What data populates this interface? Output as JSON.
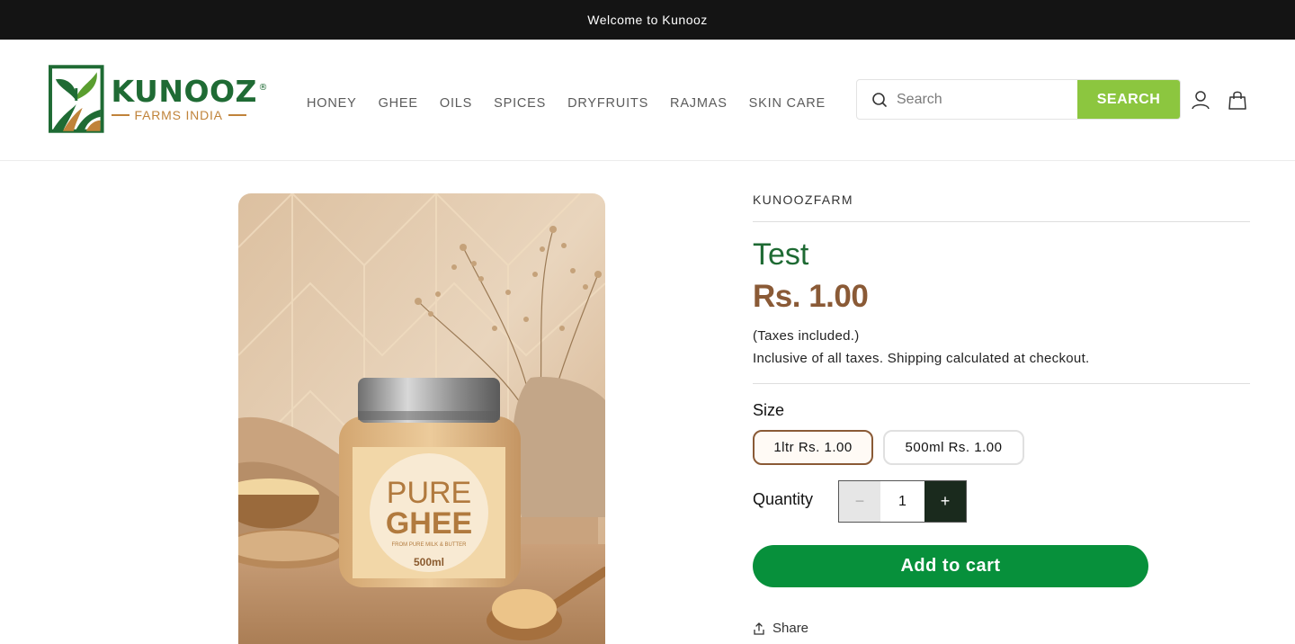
{
  "announcement": {
    "text": "Welcome to Kunooz"
  },
  "brand": {
    "name": "KUNOOZ",
    "registered": "®",
    "tagline": "FARMS INDIA",
    "colors": {
      "green": "#1f6b34",
      "brown": "#c0833a"
    }
  },
  "nav": {
    "items": [
      "HONEY",
      "GHEE",
      "OILS",
      "SPICES",
      "DRYFRUITS",
      "RAJMAS",
      "SKIN CARE"
    ]
  },
  "search": {
    "placeholder": "Search",
    "button_label": "SEARCH",
    "button_color": "#8cc63f",
    "icon": "search-icon"
  },
  "header_icons": [
    "account-icon",
    "cart-icon"
  ],
  "product": {
    "image": {
      "label_line1": "PURE",
      "label_line2": "GHEE",
      "label_small": "FROM PURE MILK & BUTTER",
      "label_size": "500ml"
    },
    "vendor": "KUNOOZFARM",
    "title": "Test",
    "price": "Rs. 1.00",
    "tax_note": "(Taxes included.)",
    "shipping_note": "Inclusive of all taxes. Shipping calculated at checkout.",
    "size_label": "Size",
    "sizes": [
      {
        "label": "1ltr Rs. 1.00",
        "selected": true
      },
      {
        "label": "500ml Rs. 1.00",
        "selected": false
      }
    ],
    "quantity_label": "Quantity",
    "quantity": {
      "value": "1",
      "minus": "−",
      "plus": "+"
    },
    "add_to_cart": "Add to cart",
    "share": "Share",
    "colors": {
      "title": "#1e6a33",
      "price": "#8a5a36",
      "cart_button": "#07903b"
    }
  }
}
